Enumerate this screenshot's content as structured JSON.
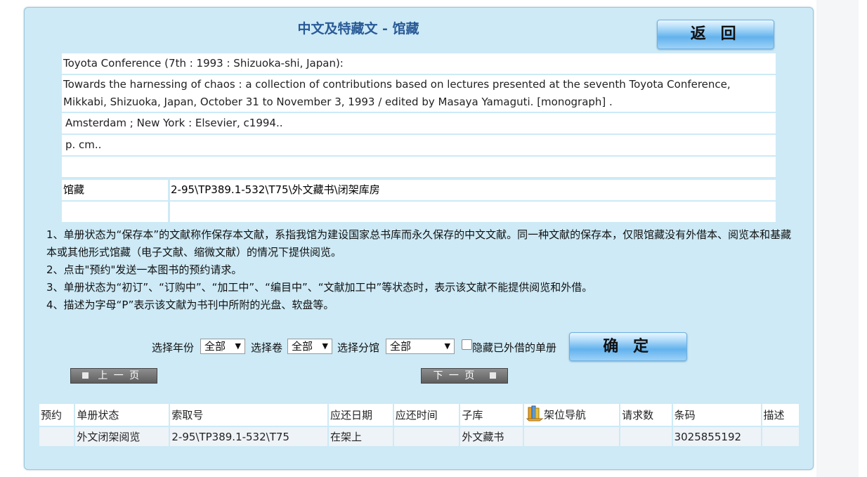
{
  "page": {
    "title": "中文及特藏文 - 馆藏",
    "return_button": "返 回",
    "confirm_button": "确 定"
  },
  "bib": {
    "line1": "Toyota Conference (7th : 1993 : Shizuoka-shi, Japan):",
    "line2": "Towards the harnessing of chaos : a collection of contributions based on lectures presented at the seventh Toyota Conference, Mikkabi, Shizuoka, Japan, October 31 to November 3, 1993 / edited by Masaya Yamaguti. [monograph] .",
    "line3": "Amsterdam ; New York : Elsevier, c1994..",
    "line4": "p. cm..",
    "holdings_label": "馆藏",
    "holdings_value": "2-95\\TP389.1-532\\T75\\外文藏书\\闭架库房"
  },
  "notes": [
    "1、单册状态为“保存本”的文献称作保存本文献，系指我馆为建设国家总书库而永久保存的中文文献。同一种文献的保存本，仅限馆藏没有外借本、阅览本和基藏本或其他形式馆藏（电子文献、缩微文献）的情况下提供阅览。",
    "2、点击\"预约\"发送一本图书的预约请求。",
    "3、单册状态为“初订”、“订购中”、“加工中”、“编目中”、“文献加工中”等状态时，表示该文献不能提供阅览和外借。",
    "4、描述为字母“P”表示该文献为书刊中所附的光盘、软盘等。"
  ],
  "filters": {
    "year_label": "选择年份",
    "year_value": "全部",
    "volume_label": "选择卷",
    "volume_value": "全部",
    "branch_label": "选择分馆",
    "branch_value": "全部",
    "hide_loaned_label": "隐藏已外借的单册"
  },
  "pager": {
    "prev": "上一页",
    "next": "下一页"
  },
  "table": {
    "headers": [
      "预约",
      "单册状态",
      "索取号",
      "应还日期",
      "应还时间",
      "子库",
      "架位导航",
      "请求数",
      "条码",
      "描述"
    ],
    "rows": [
      [
        "",
        "外文闭架阅览",
        "2-95\\TP389.1-532\\T75",
        "在架上",
        "",
        "外文藏书",
        "",
        "",
        "3025855192",
        ""
      ]
    ]
  }
}
